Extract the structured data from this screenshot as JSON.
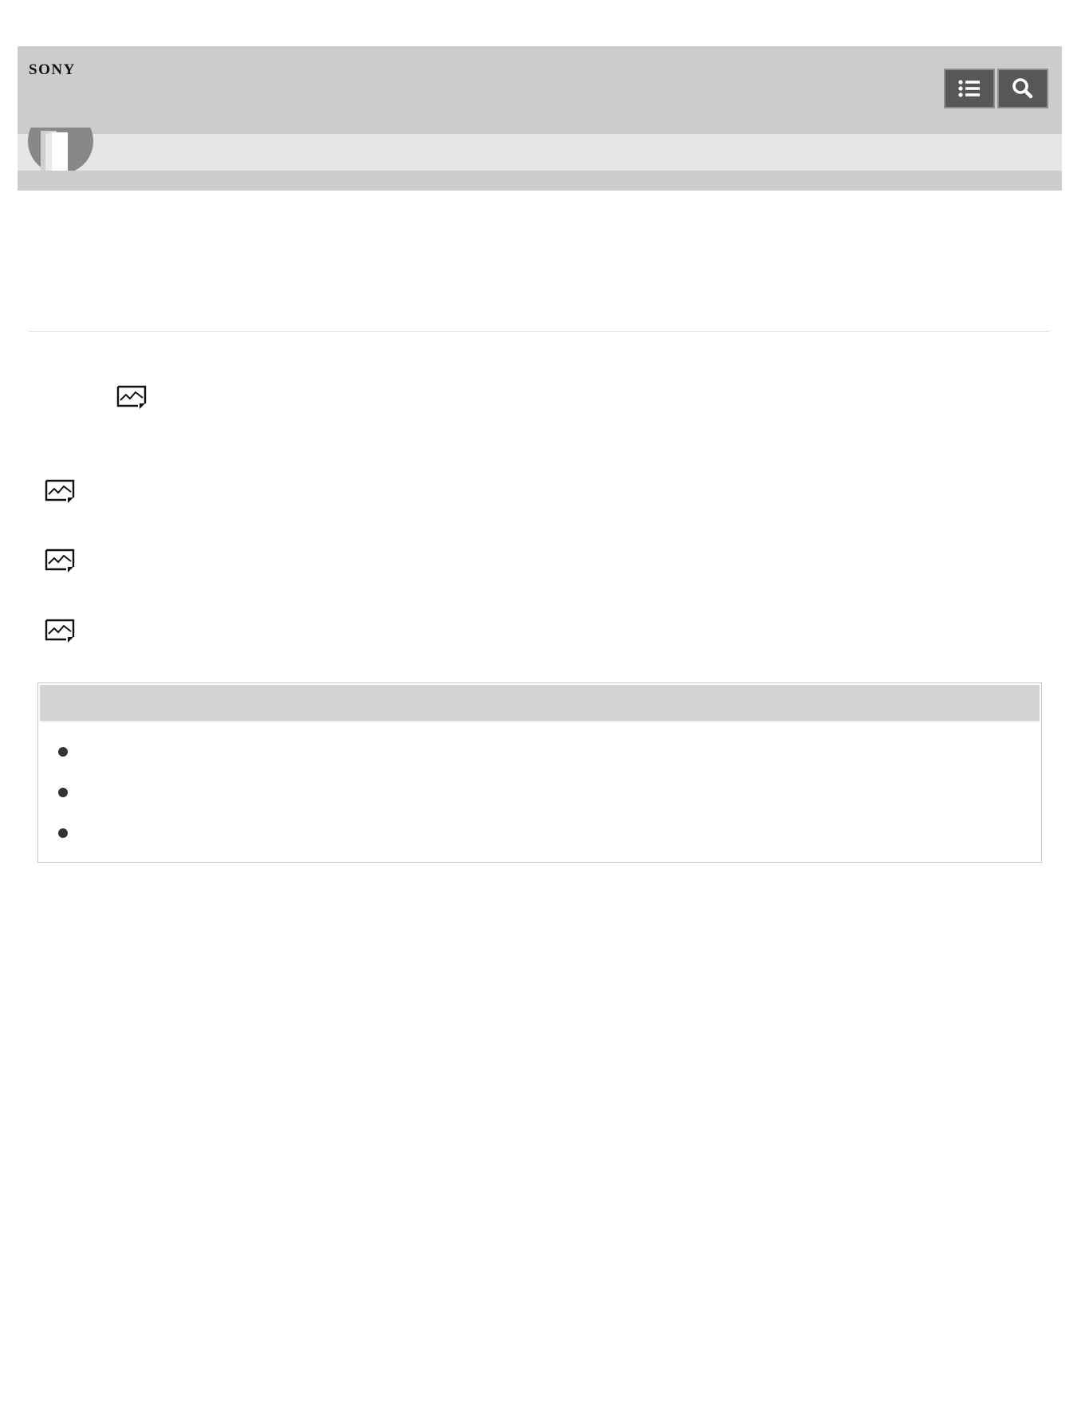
{
  "header": {
    "brand": "SONY",
    "menu_icon": "list-menu-icon",
    "search_icon": "search-icon",
    "book_icon": "book-icon"
  },
  "content": {
    "picture_icon": "picture-icon",
    "note": {
      "bullet_count": 3
    }
  }
}
